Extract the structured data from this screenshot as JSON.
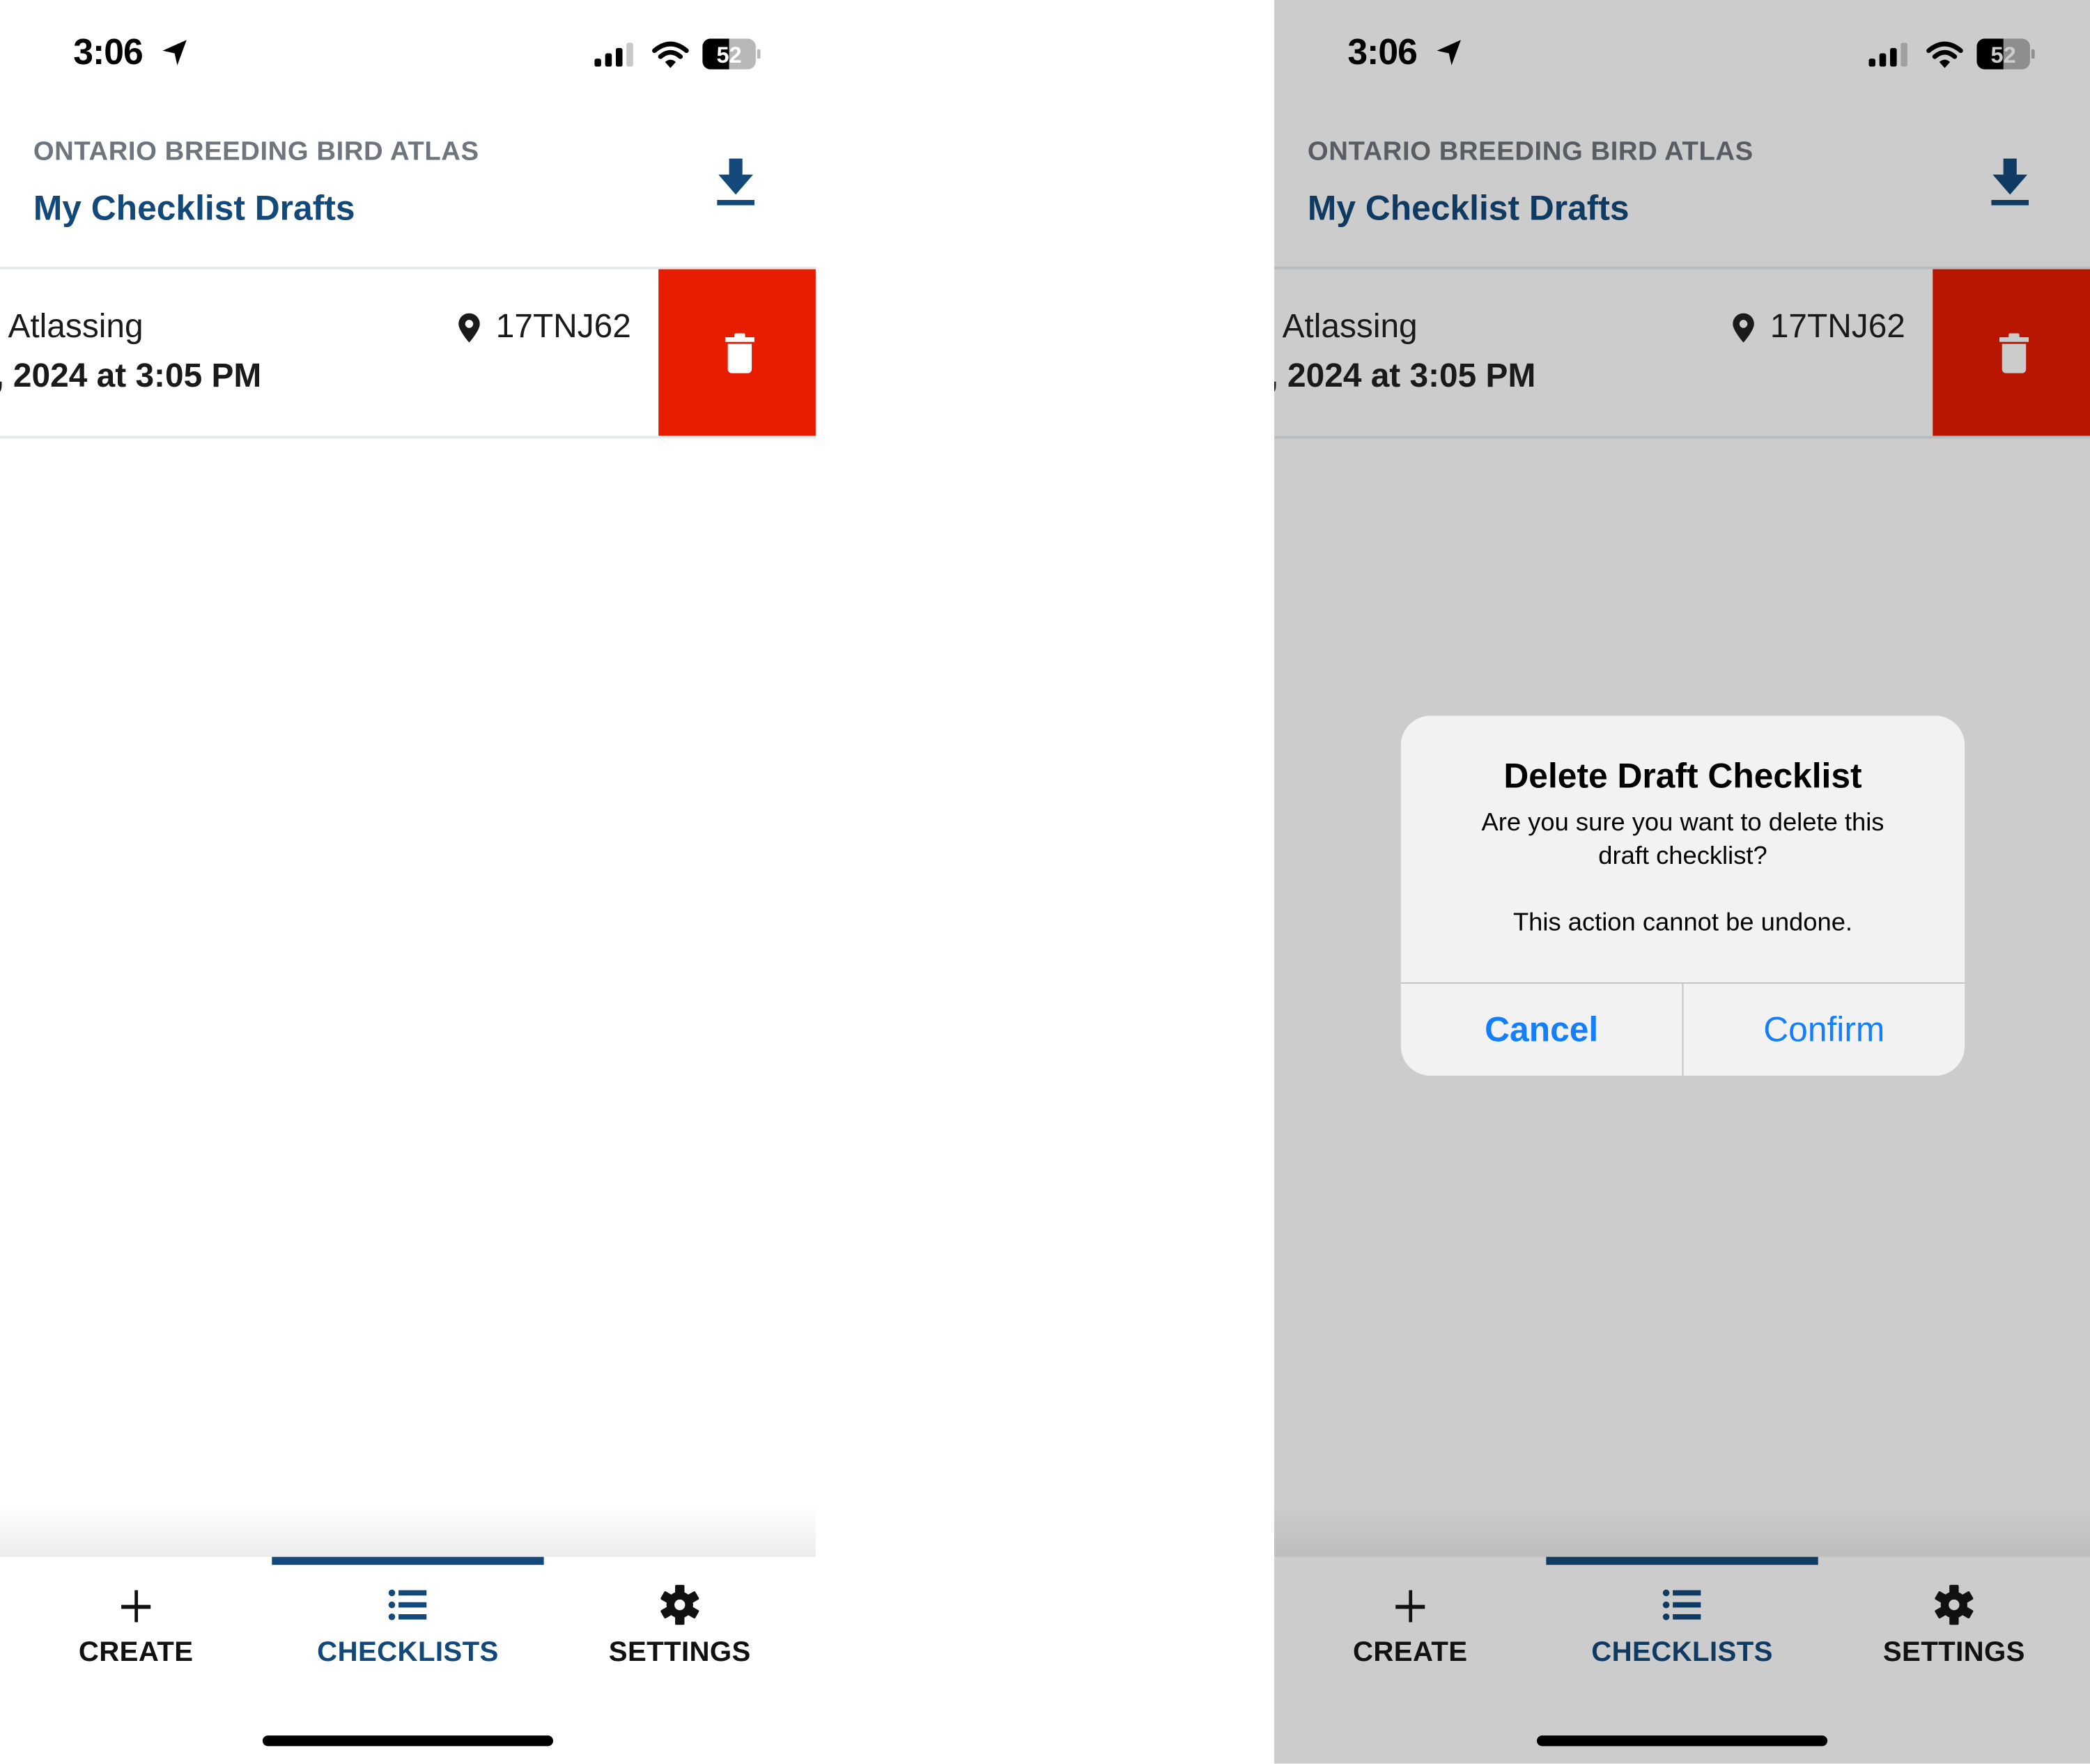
{
  "colors": {
    "brand_blue": "#13487a",
    "kicker_gray": "#6e757c",
    "delete_red": "#e81d00",
    "delete_red_dimmed": "#b91600",
    "ios_blue": "#147efb",
    "dim_overlay": "#cccccc"
  },
  "screens": [
    {
      "status_bar": {
        "time": "3:06",
        "battery_level": "52",
        "icons": [
          "location-arrow-icon",
          "cellular-signal-icon",
          "wifi-icon",
          "battery-icon"
        ]
      },
      "header": {
        "kicker": "ONTARIO BREEDING BIRD ATLAS",
        "title": "My Checklist Drafts",
        "action_icon": "download-icon"
      },
      "drafts": [
        {
          "title": "Atlassing",
          "date": ", 2024 at 3:05 PM",
          "location_icon": "map-pin-icon",
          "location_code": "17TNJ62",
          "swipe_action_icon": "trash-icon"
        }
      ],
      "tabs": [
        {
          "label": "CREATE",
          "icon": "plus-icon",
          "active": false
        },
        {
          "label": "CHECKLISTS",
          "icon": "list-icon",
          "active": true
        },
        {
          "label": "SETTINGS",
          "icon": "gear-icon",
          "active": false
        }
      ]
    },
    {
      "status_bar": {
        "time": "3:06",
        "battery_level": "52",
        "icons": [
          "location-arrow-icon",
          "cellular-signal-icon",
          "wifi-icon",
          "battery-icon"
        ]
      },
      "header": {
        "kicker": "ONTARIO BREEDING BIRD ATLAS",
        "title": "My Checklist Drafts",
        "action_icon": "download-icon"
      },
      "drafts": [
        {
          "title": "Atlassing",
          "date": ", 2024 at 3:05 PM",
          "location_icon": "map-pin-icon",
          "location_code": "17TNJ62",
          "swipe_action_icon": "trash-icon"
        }
      ],
      "tabs": [
        {
          "label": "CREATE",
          "icon": "plus-icon",
          "active": false
        },
        {
          "label": "CHECKLISTS",
          "icon": "list-icon",
          "active": true
        },
        {
          "label": "SETTINGS",
          "icon": "gear-icon",
          "active": false
        }
      ],
      "dialog": {
        "title": "Delete Draft Checklist",
        "message": "Are you sure you want to delete this\ndraft checklist?\n\nThis action cannot be undone.",
        "cancel_label": "Cancel",
        "confirm_label": "Confirm"
      }
    }
  ]
}
